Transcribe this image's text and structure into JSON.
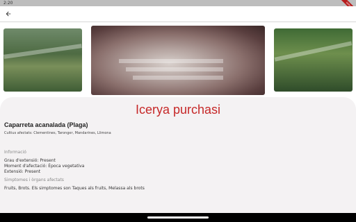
{
  "status_bar": {
    "time": "2:20"
  },
  "debug_ribbon": "DEBUG",
  "app_bar": {
    "back_icon": "arrow-back-icon"
  },
  "gallery": {
    "images": [
      {
        "name": "gallery-image-1",
        "alt": "photo"
      },
      {
        "name": "gallery-image-2",
        "alt": "photo"
      },
      {
        "name": "gallery-image-3",
        "alt": "photo"
      }
    ]
  },
  "details": {
    "scientific_name": "Icerya purchasi",
    "common_name": "Caparreta acanalada (Plaga)",
    "crops": "Cultius afectats:  Clementines, Taronger, Mandarines, Llimona",
    "info_header": "Informació",
    "info_lines": [
      "Grau d'extensió: Present",
      "Moment d'afectació: Època vegetativa",
      "Extensió: Present"
    ],
    "symptoms_header": "Simptomes i òrgans afectats",
    "symptoms": "Fruits, Brots. Els simptomes son Taques als fruits, Melassa als brots"
  },
  "colors": {
    "title": "#c62828",
    "card_bg": "#f4f2f3"
  }
}
